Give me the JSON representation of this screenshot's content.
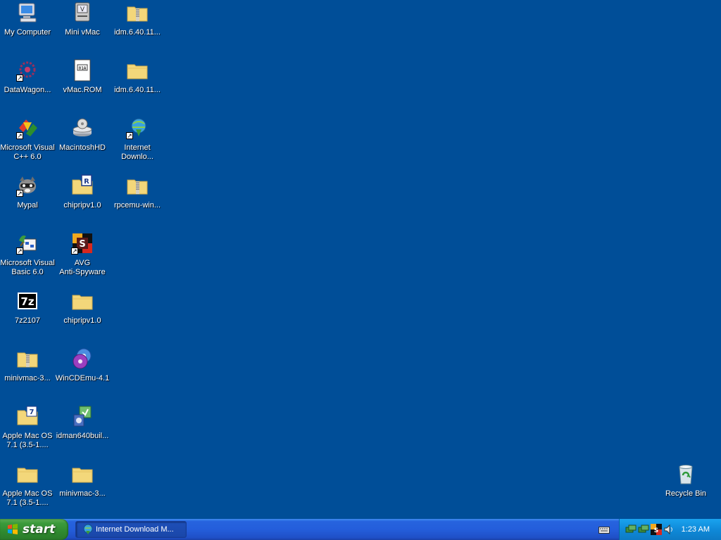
{
  "desktop": {
    "background": "#004e98",
    "icons": [
      {
        "label": "My Computer",
        "icon": "computer-icon"
      },
      {
        "label": "Mini vMac",
        "icon": "mac-app-icon"
      },
      {
        "label": "idm.6.40.11...",
        "icon": "zip-folder-icon"
      },
      {
        "label": "DataWagon...",
        "icon": "datawagon-icon"
      },
      {
        "label": "vMac.ROM",
        "icon": "rom-file-icon"
      },
      {
        "label": "idm.6.40.11...",
        "icon": "folder-icon"
      },
      {
        "label": "Microsoft Visual\nC++ 6.0",
        "icon": "visual-cpp-icon"
      },
      {
        "label": "MacintoshHD",
        "icon": "disk-drive-icon"
      },
      {
        "label": "Internet\nDownlo...",
        "icon": "idm-icon"
      },
      {
        "label": "Mypal",
        "icon": "mypal-raccoon-icon"
      },
      {
        "label": "chipripv1.0",
        "icon": "rar-folder-icon"
      },
      {
        "label": "rpcemu-win...",
        "icon": "zip-folder-icon"
      },
      {
        "label": "Microsoft Visual\nBasic 6.0",
        "icon": "visual-basic-icon"
      },
      {
        "label": "AVG\nAnti-Spyware",
        "icon": "avg-antispyware-icon"
      },
      {
        "label": "7z2107",
        "icon": "7zip-icon"
      },
      {
        "label": "chipripv1.0",
        "icon": "folder-icon"
      },
      {
        "label": "minivmac-3...",
        "icon": "zip-folder-icon"
      },
      {
        "label": "WinCDEmu-4.1",
        "icon": "wincdemu-icon"
      },
      {
        "label": "Apple Mac OS\n7.1 (3.5-1....",
        "icon": "7z-folder-icon"
      },
      {
        "label": "idman640buil...",
        "icon": "installer-icon"
      },
      {
        "label": "Apple Mac OS\n7.1 (3.5-1....",
        "icon": "folder-icon"
      },
      {
        "label": "minivmac-3...",
        "icon": "folder-icon"
      },
      {
        "label": "Recycle Bin",
        "icon": "recycle-bin-icon"
      }
    ]
  },
  "taskbar": {
    "start_label": "start",
    "tasks": [
      {
        "label": "Internet Download M...",
        "icon": "idm-icon"
      }
    ],
    "tray_icons": [
      "network-icon",
      "network-icon",
      "antispyware-icon",
      "volume-icon"
    ],
    "clock": "1:23 AM",
    "keyboard_icon": "keyboard-icon"
  }
}
